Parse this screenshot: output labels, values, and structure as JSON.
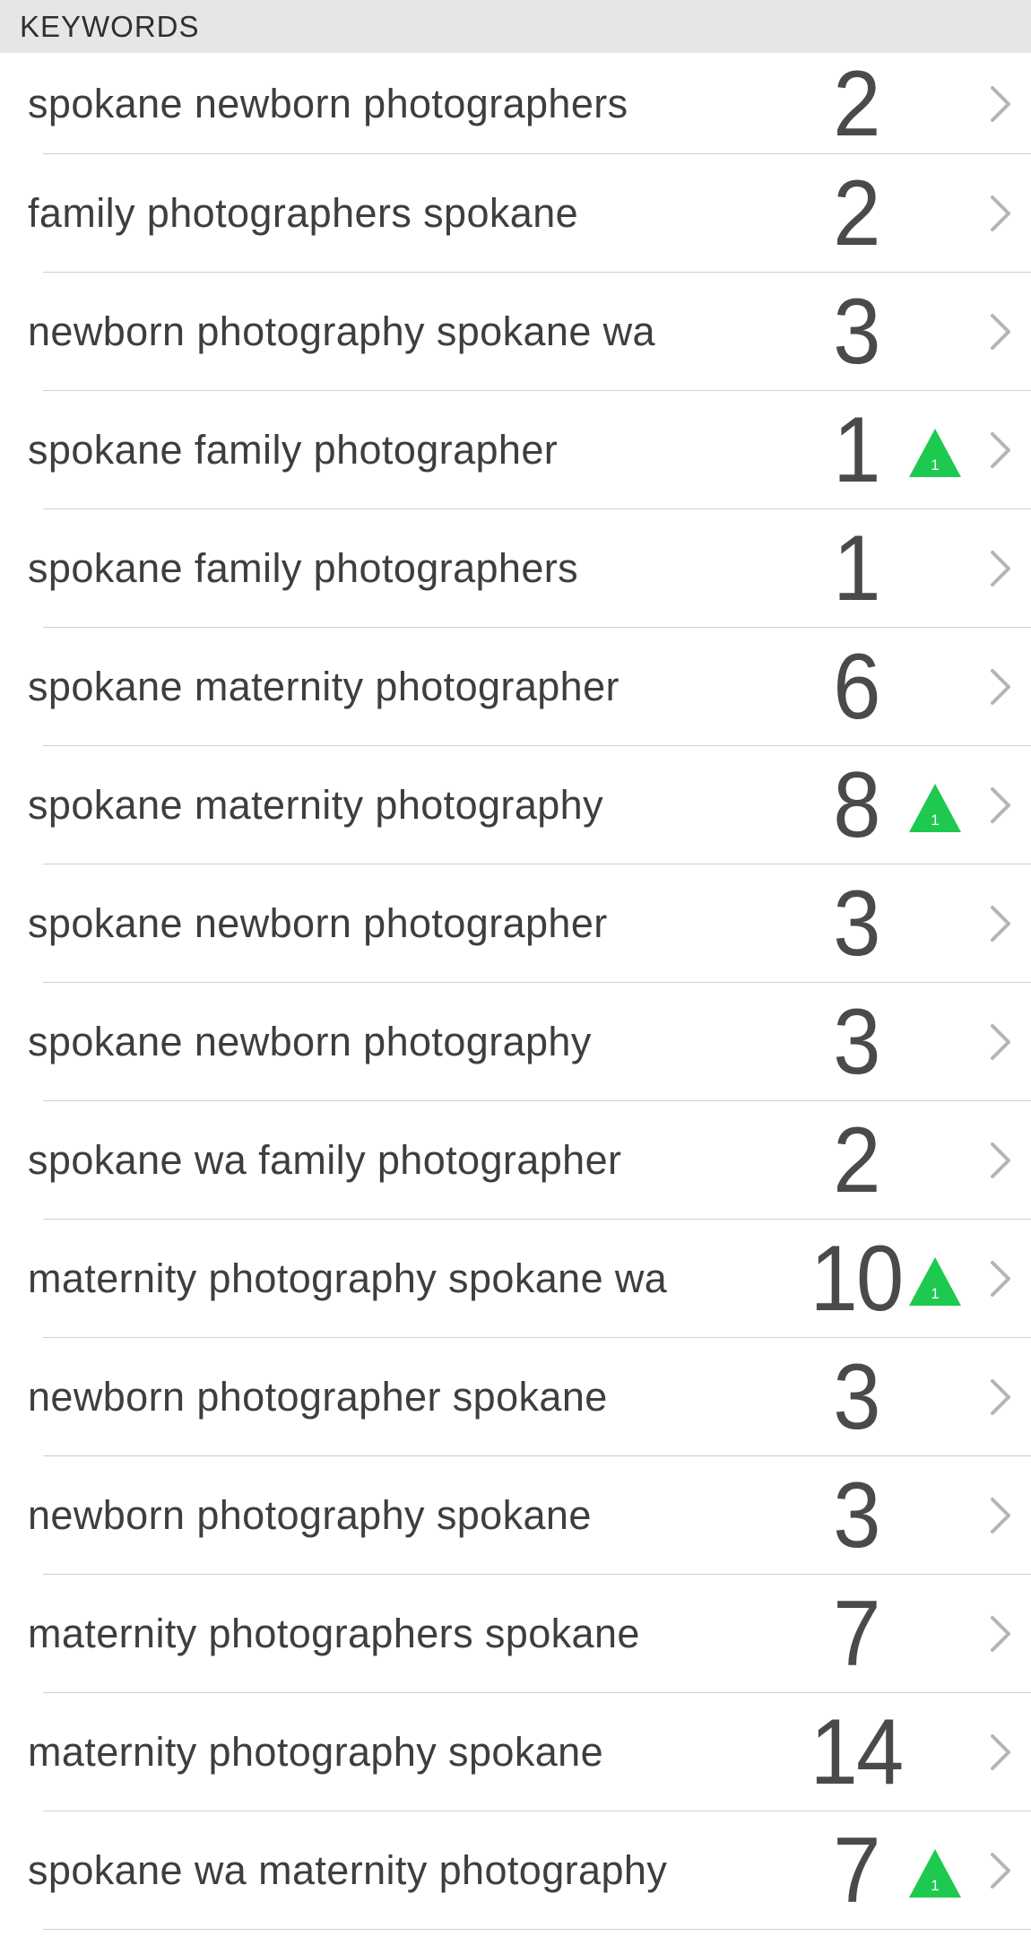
{
  "header": {
    "title": "KEYWORDS"
  },
  "colors": {
    "up": "#1ec94f",
    "chevron": "#b5b5b5",
    "separator": "#cfcfcf"
  },
  "keywords": [
    {
      "label": "spokane newborn photographers",
      "rank": "2",
      "change": ""
    },
    {
      "label": "family photographers spokane",
      "rank": "2",
      "change": ""
    },
    {
      "label": "newborn photography spokane wa",
      "rank": "3",
      "change": ""
    },
    {
      "label": "spokane family photographer",
      "rank": "1",
      "change": "1"
    },
    {
      "label": "spokane family photographers",
      "rank": "1",
      "change": ""
    },
    {
      "label": "spokane maternity photographer",
      "rank": "6",
      "change": ""
    },
    {
      "label": "spokane maternity photography",
      "rank": "8",
      "change": "1"
    },
    {
      "label": "spokane newborn photographer",
      "rank": "3",
      "change": ""
    },
    {
      "label": "spokane newborn photography",
      "rank": "3",
      "change": ""
    },
    {
      "label": "spokane wa family photographer",
      "rank": "2",
      "change": ""
    },
    {
      "label": "maternity photography spokane wa",
      "rank": "10",
      "change": "1"
    },
    {
      "label": "newborn photographer spokane",
      "rank": "3",
      "change": ""
    },
    {
      "label": "newborn photography spokane",
      "rank": "3",
      "change": ""
    },
    {
      "label": "maternity photographers spokane",
      "rank": "7",
      "change": ""
    },
    {
      "label": "maternity photography spokane",
      "rank": "14",
      "change": ""
    },
    {
      "label": "spokane wa maternity photography",
      "rank": "7",
      "change": "1"
    }
  ]
}
